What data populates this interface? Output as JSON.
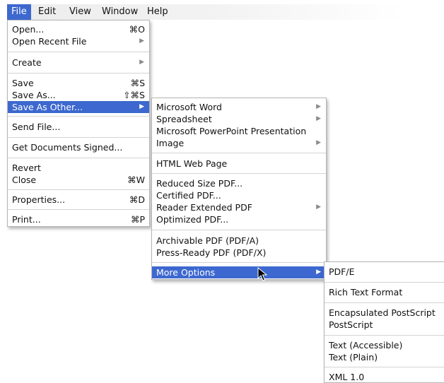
{
  "menubar": {
    "file": "File",
    "edit": "Edit",
    "view": "View",
    "window": "Window",
    "help": "Help"
  },
  "file_menu": {
    "open": "Open...",
    "open_shortcut": "⌘O",
    "open_recent": "Open Recent File",
    "create": "Create",
    "save": "Save",
    "save_shortcut": "⌘S",
    "save_as": "Save As...",
    "save_as_shortcut": "⇧⌘S",
    "save_as_other": "Save As Other...",
    "send_file": "Send File...",
    "get_signed": "Get Documents Signed...",
    "revert": "Revert",
    "close": "Close",
    "close_shortcut": "⌘W",
    "properties": "Properties...",
    "properties_shortcut": "⌘D",
    "print": "Print...",
    "print_shortcut": "⌘P"
  },
  "save_as_other_menu": {
    "microsoft_word": "Microsoft Word",
    "spreadsheet": "Spreadsheet",
    "powerpoint": "Microsoft PowerPoint Presentation",
    "image": "Image",
    "html_web_page": "HTML Web Page",
    "reduced_size_pdf": "Reduced Size PDF...",
    "certified_pdf": "Certified PDF...",
    "reader_extended_pdf": "Reader Extended PDF",
    "optimized_pdf": "Optimized PDF...",
    "archivable_pdf": "Archivable PDF (PDF/A)",
    "press_ready_pdf": "Press-Ready PDF (PDF/X)",
    "more_options": "More Options"
  },
  "more_options_menu": {
    "pdf_e": "PDF/E",
    "rich_text": "Rich Text Format",
    "eps": "Encapsulated PostScript",
    "postscript": "PostScript",
    "text_accessible": "Text (Accessible)",
    "text_plain": "Text (Plain)",
    "xml": "XML 1.0"
  },
  "icons": {
    "submenu": "submenu-arrow-icon",
    "cursor": "mouse-pointer-icon"
  },
  "colors": {
    "highlight": "#3d68cf",
    "menu_bg": "#ffffff",
    "separator": "#d4d4d4"
  }
}
